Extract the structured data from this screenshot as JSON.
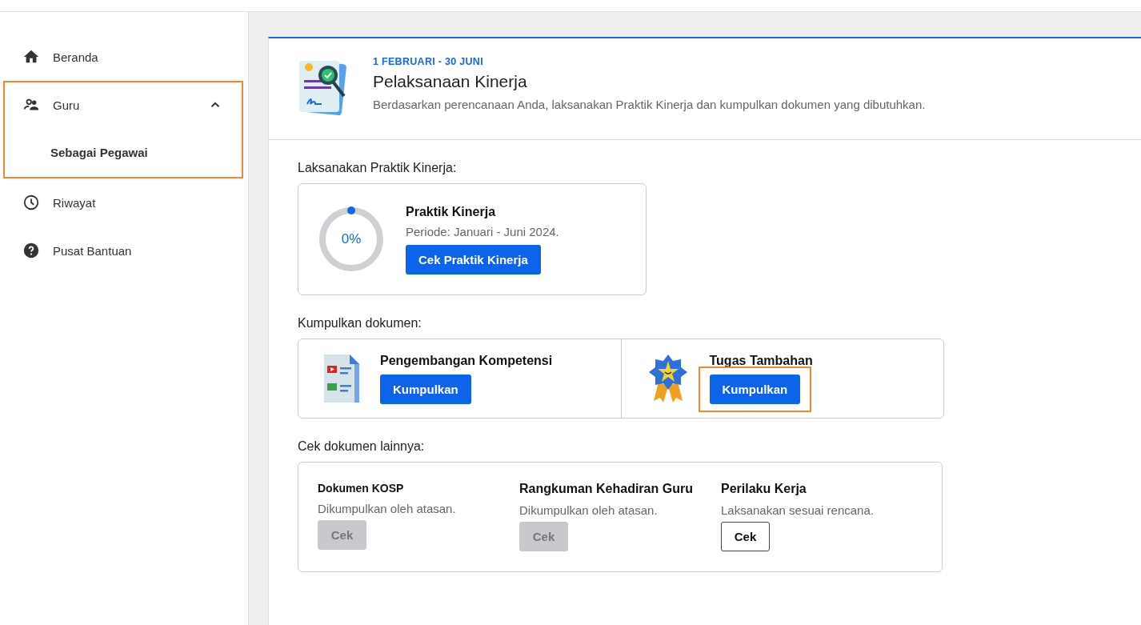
{
  "sidebar": {
    "items": [
      {
        "label": "Beranda",
        "kind": "home",
        "selected": false
      },
      {
        "label": "Guru",
        "kind": "group",
        "selected": false,
        "highlighted": true,
        "expanded": true,
        "children": [
          {
            "label": "Sebagai Pegawai",
            "selected": true
          }
        ]
      },
      {
        "label": "Riwayat",
        "kind": "clock",
        "selected": false
      },
      {
        "label": "Pusat Bantuan",
        "kind": "help",
        "selected": false
      }
    ]
  },
  "header": {
    "date_range": "1 FEBRUARI - 30 JUNI",
    "title": "Pelaksanaan Kinerja",
    "description": "Berdasarkan perencanaan Anda, laksanakan Praktik Kinerja dan kumpulkan dokumen yang dibutuhkan."
  },
  "practice": {
    "heading": "Laksanakan Praktik Kinerja:",
    "title": "Praktik Kinerja",
    "percent": "0%",
    "period": "Periode: Januari - Juni 2024.",
    "button": "Cek Praktik Kinerja"
  },
  "collect": {
    "heading": "Kumpulkan dokumen:",
    "items": [
      {
        "kind": "document",
        "title": "Pengembangan Kompetensi",
        "button": "Kumpulkan",
        "highlighted": false
      },
      {
        "kind": "medal",
        "title": "Tugas Tambahan",
        "button": "Kumpulkan",
        "highlighted": true
      }
    ]
  },
  "others": {
    "heading": "Cek dokumen lainnya:",
    "items": [
      {
        "title": "Dokumen KOSP",
        "note": "Dikumpulkan oleh atasan.",
        "button": "Cek",
        "disabled": true
      },
      {
        "title": "Rangkuman Kehadiran Guru",
        "note": "Dikumpulkan oleh atasan.",
        "button": "Cek",
        "disabled": true
      },
      {
        "title": "Perilaku Kerja",
        "note": "Laksanakan sesuai rencana.",
        "button": "Cek",
        "disabled": false
      }
    ]
  }
}
